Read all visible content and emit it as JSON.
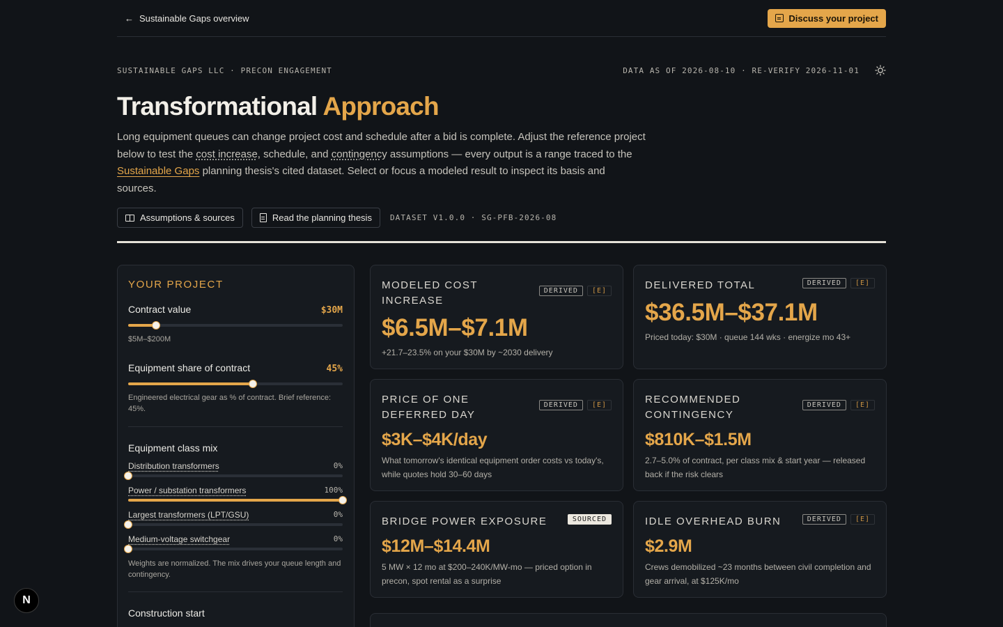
{
  "nav": {
    "back_label": "Sustainable Gaps overview",
    "cta_label": "Discuss your project"
  },
  "meta": {
    "left": "SUSTAINABLE GAPS LLC · PRECON ENGAGEMENT",
    "right": "DATA AS OF 2026-08-10 · RE-VERIFY 2026-11-01"
  },
  "hero": {
    "title_a": "Transformational",
    "title_b": "Approach",
    "intro_1": "Long equipment queues can change project cost and schedule after a bid is complete. Adjust the reference project below to test the ",
    "intro_link1": "cost increase",
    "intro_2": ", schedule, and ",
    "intro_link2": "contingency",
    "intro_3": " assumptions — every output is a range traced to the ",
    "intro_link3": "Sustainable Gaps",
    "intro_4": " planning thesis's cited dataset. Select or focus a modeled result to inspect its basis and sources."
  },
  "actions": {
    "assumptions_label": "Assumptions & sources",
    "thesis_label": "Read the planning thesis",
    "dataset": "DATASET V1.0.0 · SG-PFB-2026-08"
  },
  "project": {
    "title": "YOUR PROJECT",
    "contract": {
      "label": "Contract value",
      "value": "$30M",
      "range": "$5M–$200M",
      "level": 0.13
    },
    "equipment": {
      "label": "Equipment share of contract",
      "value": "45%",
      "hint": "Engineered electrical gear as % of contract. Brief reference: 45%.",
      "level": 0.58
    },
    "mix_title": "Equipment class mix",
    "mix": [
      {
        "name": "Distribution transformers",
        "pct": "0%",
        "level": 0
      },
      {
        "name": "Power / substation transformers",
        "pct": "100%",
        "level": 1
      },
      {
        "name": "Largest transformers (LPT/GSU)",
        "pct": "0%",
        "level": 0
      },
      {
        "name": "Medium-voltage switchgear",
        "pct": "0%",
        "level": 0
      }
    ],
    "mix_hint": "Weights are normalized. The mix drives your queue length and contingency.",
    "construction_label": "Construction start"
  },
  "cards": {
    "cost": {
      "title": "MODELED COST INCREASE",
      "tag": "DERIVED",
      "e": "[E]",
      "value": "$6.5M–$7.1M",
      "note": "+21.7–23.5% on your $30M by ~2030 delivery"
    },
    "total": {
      "title": "DELIVERED TOTAL",
      "tag": "DERIVED",
      "e": "[E]",
      "value": "$36.5M–$37.1M",
      "note": "Priced today: $30M · queue 144 wks · energize mo 43+"
    },
    "day": {
      "title": "PRICE OF ONE DEFERRED DAY",
      "tag": "DERIVED",
      "e": "[E]",
      "value": "$3K–$4K/day",
      "note": "What tomorrow's identical equipment order costs vs today's, while quotes hold 30–60 days"
    },
    "contingency": {
      "title": "RECOMMENDED CONTINGENCY",
      "tag": "DERIVED",
      "e": "[E]",
      "value": "$810K–$1.5M",
      "note": "2.7–5.0% of contract, per class mix & start year — released back if the risk clears"
    },
    "bridge": {
      "title": "BRIDGE POWER EXPOSURE",
      "tag": "SOURCED",
      "value": "$12M–$14.4M",
      "note": "5 MW × 12 mo at $200–240K/MW-mo — priced option in precon, spot rental as a surprise"
    },
    "idle": {
      "title": "IDLE OVERHEAD BURN",
      "tag": "DERIVED",
      "e": "[E]",
      "value": "$2.9M",
      "note": "Crews demobilized ~23 months between civil completion and gear arrival, at $125K/mo"
    }
  },
  "badge": "N"
}
